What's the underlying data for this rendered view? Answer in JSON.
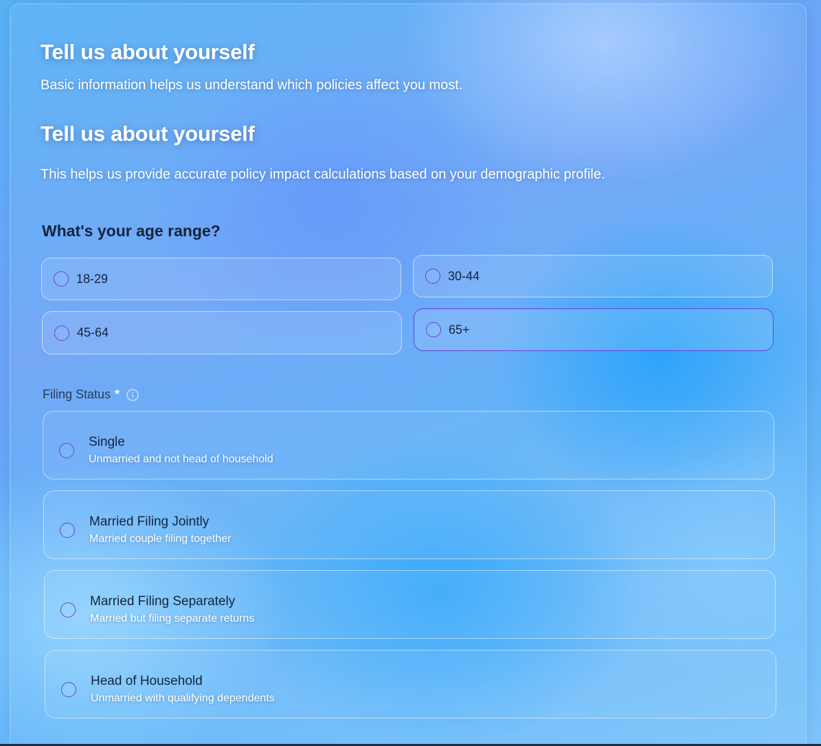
{
  "header": {
    "title": "Tell us about yourself",
    "subtitle": "Basic information helps us understand which policies affect you most."
  },
  "section": {
    "title": "Tell us about yourself",
    "subtitle": "This helps us provide accurate policy impact calculations based on your demographic profile."
  },
  "age": {
    "question": "What's your age range?",
    "options": [
      {
        "label": "18-29"
      },
      {
        "label": "30-44"
      },
      {
        "label": "45-64"
      },
      {
        "label": "65+"
      }
    ],
    "highlighted": "65+"
  },
  "filing": {
    "label": "Filing Status",
    "required_marker": "*",
    "options": [
      {
        "title": "Single",
        "description": "Unmarried and not head of household"
      },
      {
        "title": "Married Filing Jointly",
        "description": "Married couple filing together"
      },
      {
        "title": "Married Filing Separately",
        "description": "Married but filing separate returns"
      },
      {
        "title": "Head of Household",
        "description": "Unmarried with qualifying dependents"
      }
    ]
  },
  "colors": {
    "accent": "#6a3fe0",
    "text_dark": "#17233d",
    "text_light": "#ffffff"
  },
  "icons": {
    "info": "info-circle-icon"
  }
}
